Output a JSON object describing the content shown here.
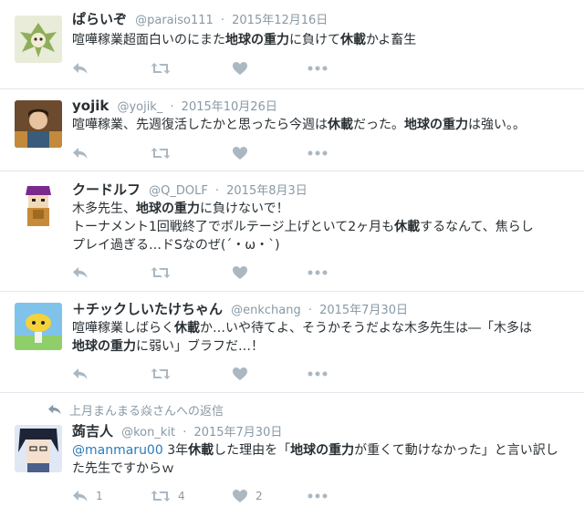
{
  "tweets": [
    {
      "fullname": "ぱらいぞ",
      "username": "@paraiso111",
      "separator": "·",
      "time": "2015年12月16日",
      "text": [
        [
          {
            "t": "喧嘩稼業超面白いのにまた",
            "s": "plain"
          },
          {
            "t": "地球の重力",
            "s": "bold"
          },
          {
            "t": "に負けて",
            "s": "plain"
          },
          {
            "t": "休載",
            "s": "bold"
          },
          {
            "t": "かよ畜生",
            "s": "plain"
          }
        ]
      ],
      "reply_count": "",
      "retweet_count": "",
      "like_count": ""
    },
    {
      "fullname": "yojik",
      "username": "@yojik_",
      "separator": "·",
      "time": "2015年10月26日",
      "text": [
        [
          {
            "t": "喧嘩稼業、先週復活したかと思ったら今週は",
            "s": "plain"
          },
          {
            "t": "休載",
            "s": "bold"
          },
          {
            "t": "だった。",
            "s": "plain"
          },
          {
            "t": "地球の重力",
            "s": "bold"
          },
          {
            "t": "は強い。。",
            "s": "plain"
          }
        ]
      ],
      "reply_count": "",
      "retweet_count": "",
      "like_count": ""
    },
    {
      "fullname": "クードルフ",
      "username": "@Q_DOLF",
      "separator": "·",
      "time": "2015年8月3日",
      "text": [
        [
          {
            "t": "木多先生、",
            "s": "plain"
          },
          {
            "t": "地球の重力",
            "s": "bold"
          },
          {
            "t": "に負けないで！",
            "s": "plain"
          }
        ],
        [
          {
            "t": "トーナメント1回戦終了でボルテージ上げといて2ヶ月も",
            "s": "plain"
          },
          {
            "t": "休載",
            "s": "bold"
          },
          {
            "t": "するなんて、焦らし",
            "s": "plain"
          }
        ],
        [
          {
            "t": "プレイ過ぎる…ドSなのぜ(´・ω・`)",
            "s": "plain"
          }
        ]
      ],
      "reply_count": "",
      "retweet_count": "",
      "like_count": ""
    },
    {
      "fullname": "＋チックしいたけちゃん",
      "username": "@enkchang",
      "separator": "·",
      "time": "2015年7月30日",
      "text": [
        [
          {
            "t": "喧嘩稼業しばらく",
            "s": "plain"
          },
          {
            "t": "休載",
            "s": "bold"
          },
          {
            "t": "か…いや待てよ、そうかそうだよな木多先生は―「木多は",
            "s": "plain"
          }
        ],
        [
          {
            "t": "地球の重力",
            "s": "bold"
          },
          {
            "t": "に弱い」ブラフだ…！",
            "s": "plain"
          }
        ]
      ],
      "reply_count": "",
      "retweet_count": "",
      "like_count": ""
    },
    {
      "context": "上月まんまる焱さんへの返信",
      "fullname": "蒟吉人",
      "username": "@kon_kit",
      "separator": "·",
      "time": "2015年7月30日",
      "text": [
        [
          {
            "t": "@manmaru00",
            "s": "mention"
          },
          {
            "t": " 3年",
            "s": "plain"
          },
          {
            "t": "休載",
            "s": "bold"
          },
          {
            "t": "した理由を「",
            "s": "plain"
          },
          {
            "t": "地球の重力",
            "s": "bold"
          },
          {
            "t": "が重くて動けなかった」と言い訳し",
            "s": "plain"
          }
        ],
        [
          {
            "t": "た先生ですからｗ",
            "s": "plain"
          }
        ]
      ],
      "reply_count": "1",
      "retweet_count": "4",
      "like_count": "2"
    }
  ],
  "icons": {
    "reply": "reply-icon",
    "retweet": "retweet-icon",
    "like": "heart-icon",
    "more": "more-icon",
    "context": "reply-context-icon"
  },
  "colors": {
    "text": "#292f33",
    "meta": "#8899a6",
    "action_icon": "#aab8c2",
    "mention": "#2b7bb9",
    "divider": "#e1e8ed"
  }
}
